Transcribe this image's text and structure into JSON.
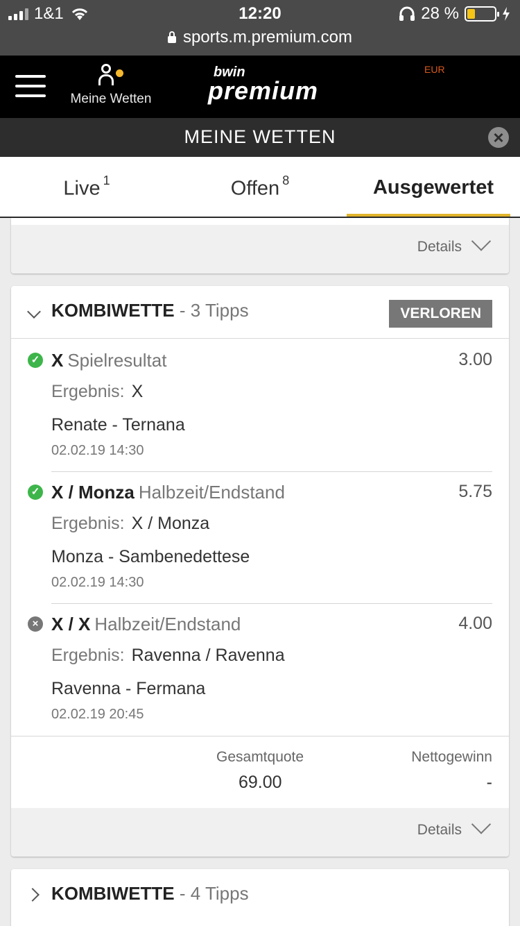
{
  "statusbar": {
    "carrier": "1&1",
    "time": "12:20",
    "battery": "28 %",
    "battery_level_pct": 28
  },
  "urlbar": {
    "url": "sports.m.premium.com"
  },
  "header": {
    "my_bets_label": "Meine Wetten",
    "logo_top": "bwin",
    "logo_main": "premium",
    "currency_fragment": "EUR"
  },
  "titlebar": {
    "title": "MEINE WETTEN"
  },
  "tabs": [
    {
      "label": "Live",
      "count": "1"
    },
    {
      "label": "Offen",
      "count": "8"
    },
    {
      "label": "Ausgewertet",
      "count": ""
    }
  ],
  "details_label": "Details",
  "bet1": {
    "type": "KOMBIWETTE",
    "tips": "- 3 Tipps",
    "status": "VERLOREN",
    "selections": [
      {
        "pick": "X",
        "market": "Spielresultat",
        "odds": "3.00",
        "result_label": "Ergebnis:",
        "result": "X",
        "event": "Renate - Ternana",
        "date": "02.02.19 14:30",
        "state": "won"
      },
      {
        "pick": "X / Monza",
        "market": "Halbzeit/Endstand",
        "odds": "5.75",
        "result_label": "Ergebnis:",
        "result": "X / Monza",
        "event": "Monza - Sambenedettese",
        "date": "02.02.19 14:30",
        "state": "won"
      },
      {
        "pick": "X / X",
        "market": "Halbzeit/Endstand",
        "odds": "4.00",
        "result_label": "Ergebnis:",
        "result": "Ravenna / Ravenna",
        "event": "Ravenna - Fermana",
        "date": "02.02.19 20:45",
        "state": "lost"
      }
    ],
    "total_odds_label": "Gesamtquote",
    "total_odds": "69.00",
    "net_win_label": "Nettogewinn",
    "net_win": "-"
  },
  "bet2": {
    "type": "KOMBIWETTE",
    "tips": "- 4 Tipps"
  },
  "colors": {
    "accent": "#e0b42c",
    "won": "#3db54a",
    "lost": "#777777",
    "header": "#000000"
  }
}
